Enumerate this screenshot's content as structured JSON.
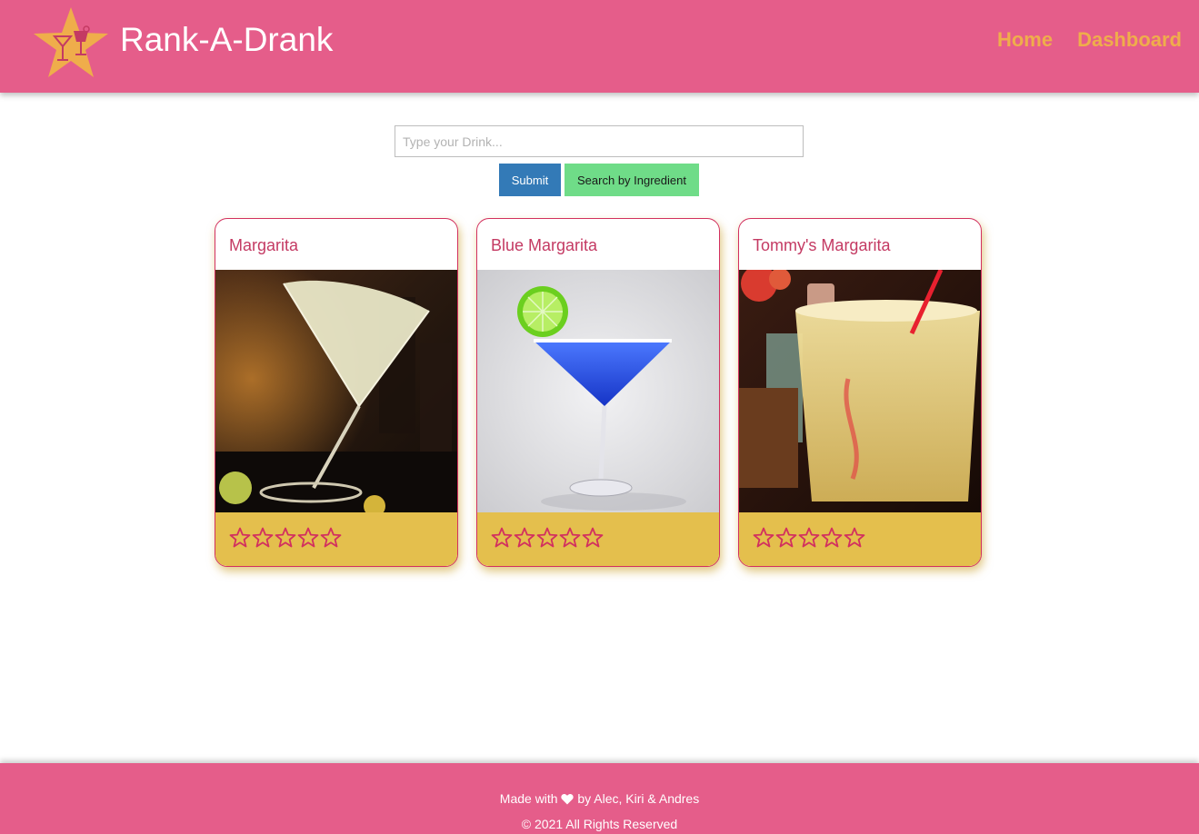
{
  "header": {
    "brand": "Rank-A-Drank",
    "nav": [
      {
        "label": "Home"
      },
      {
        "label": "Dashboard"
      }
    ],
    "logo_icon": "star-cocktail-logo",
    "background_color": "#e55d8a",
    "nav_color": "#efad4b"
  },
  "search": {
    "placeholder": "Type your Drink...",
    "value": "",
    "submit_label": "Submit",
    "ingredient_label": "Search by Ingredient"
  },
  "cards": [
    {
      "title": "Margarita",
      "rating": 0,
      "max_rating": 5,
      "image": "classic-margarita-photo"
    },
    {
      "title": "Blue Margarita",
      "rating": 0,
      "max_rating": 5,
      "image": "blue-margarita-photo"
    },
    {
      "title": "Tommy's Margarita",
      "rating": 0,
      "max_rating": 5,
      "image": "tommys-margarita-photo"
    }
  ],
  "footer": {
    "made_prefix": "Made with",
    "made_suffix": "by Alec, Kiri & Andres",
    "copyright": "© 2021 All Rights Reserved",
    "heart_icon": "heart-icon"
  },
  "colors": {
    "card_border": "#d2305f",
    "card_title": "#c43a63",
    "rating_bar": "#e4bf4d",
    "star_outline": "#d2305f",
    "submit_button": "#337ab7",
    "ingredient_button": "#6fdc88"
  }
}
